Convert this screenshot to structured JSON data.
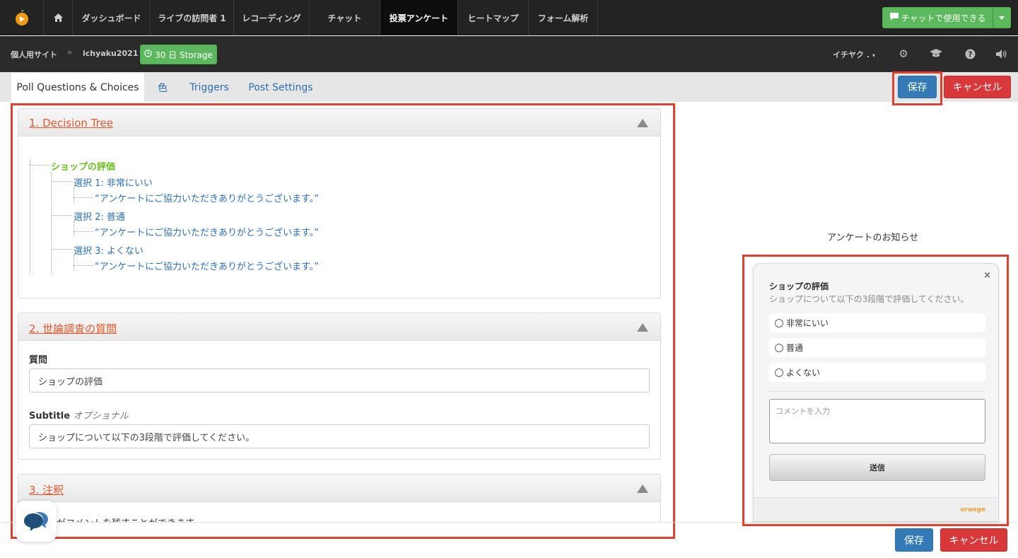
{
  "topnav": {
    "items": [
      {
        "label": "ダッシュボード"
      },
      {
        "label": "ライブの訪問者 1"
      },
      {
        "label": "レコーディング"
      },
      {
        "label": "チャット"
      },
      {
        "label": "投票アンケート"
      },
      {
        "label": "ヒートマップ"
      },
      {
        "label": "フォーム解析"
      }
    ],
    "chat_button": "チャットで使用できる"
  },
  "subbar": {
    "site_label": "個人用サイト",
    "separator": "»",
    "account": "ichyaku2021",
    "storage": "30 日 Storage",
    "user_menu": "イチヤク ."
  },
  "tabs": [
    {
      "label": "Poll Questions & Choices"
    },
    {
      "label": "色"
    },
    {
      "label": "Triggers"
    },
    {
      "label": "Post Settings"
    }
  ],
  "actions": {
    "save": "保存",
    "cancel": "キャンセル"
  },
  "panels": {
    "decision_tree": {
      "title": "1. Decision Tree",
      "root": "ショップの評価",
      "choices": [
        {
          "label": "選択 1: 非常にいい",
          "message": "“アンケートにご協力いただきありがとうございます。”"
        },
        {
          "label": "選択 2: 普通",
          "message": "“アンケートにご協力いただきありがとうございます。”"
        },
        {
          "label": "選択 3: よくない",
          "message": "“アンケートにご協力いただきありがとうございます。”"
        }
      ]
    },
    "question": {
      "title": "2. 世論調査の質問",
      "question_label": "質問",
      "question_value": "ショップの評価",
      "subtitle_label": "Subtitle",
      "subtitle_optional": "オプショナル",
      "subtitle_value": "ショップについて以下の3段階で評価してください。"
    },
    "notes": {
      "title": "3. 注釈",
      "text": "訪問者がコメントを残すことができます。"
    }
  },
  "preview": {
    "heading": "アンケートのお知らせ",
    "close": "×",
    "question": "ショップの評価",
    "subtitle": "ショップについて以下の3段階で評価してください。",
    "options": [
      "非常にいい",
      "普通",
      "よくない"
    ],
    "comment_placeholder": "コメントを入力",
    "submit": "送信",
    "brand": "orange"
  },
  "colors": {
    "highlight": "#e0412f",
    "primary": "#337ab7",
    "danger": "#d9383a",
    "success": "#5cb85c",
    "link": "#2a6fb3",
    "panel_title": "#e2582a",
    "tree_root": "#6bbf1e"
  },
  "icons": [
    "app-logo-icon",
    "home-icon",
    "chat-icon",
    "caret-down-icon",
    "clock-icon",
    "gear-icon",
    "graduation-cap-icon",
    "help-icon",
    "speaker-icon",
    "chat-bubble-icon"
  ]
}
